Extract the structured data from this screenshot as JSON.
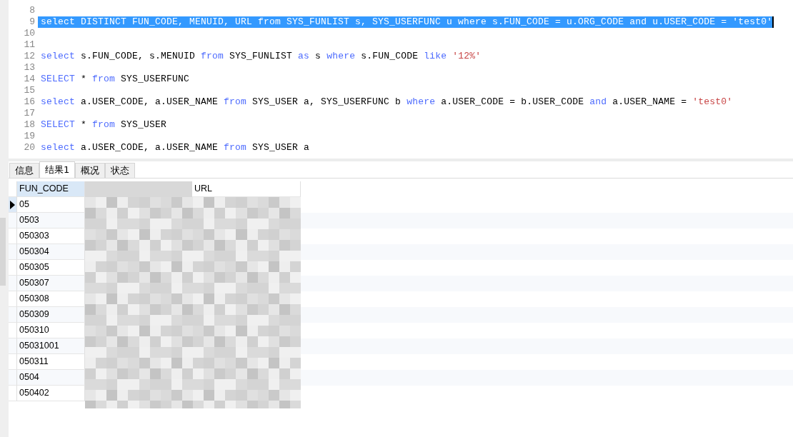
{
  "editor": {
    "lines": [
      {
        "number": "8",
        "selected": false
      },
      {
        "number": "9",
        "selected": true,
        "tokens": [
          {
            "kind": "plain",
            "text": "select DISTINCT FUN_CODE, MENUID, URL from SYS_FUNLIST s, SYS_USERFUNC u where s.FUN_CODE = u.ORG_CODE and u.USER_CODE = 'test0'"
          }
        ]
      },
      {
        "number": "10",
        "selected": false
      },
      {
        "number": "11",
        "selected": false
      },
      {
        "number": "12",
        "selected": false,
        "tokens": [
          {
            "kind": "keyword",
            "text": "select"
          },
          {
            "kind": "plain",
            "text": " s.FUN_CODE, s.MENUID "
          },
          {
            "kind": "keyword",
            "text": "from"
          },
          {
            "kind": "plain",
            "text": " SYS_FUNLIST "
          },
          {
            "kind": "keyword",
            "text": "as"
          },
          {
            "kind": "plain",
            "text": " s "
          },
          {
            "kind": "keyword",
            "text": "where"
          },
          {
            "kind": "plain",
            "text": " s.FUN_CODE "
          },
          {
            "kind": "keyword",
            "text": "like"
          },
          {
            "kind": "string",
            "text": " '12%'"
          }
        ]
      },
      {
        "number": "13",
        "selected": false
      },
      {
        "number": "14",
        "selected": false,
        "tokens": [
          {
            "kind": "keyword",
            "text": "SELECT"
          },
          {
            "kind": "plain",
            "text": " * "
          },
          {
            "kind": "keyword",
            "text": "from"
          },
          {
            "kind": "plain",
            "text": " SYS_USERFUNC"
          }
        ]
      },
      {
        "number": "15",
        "selected": false
      },
      {
        "number": "16",
        "selected": false,
        "tokens": [
          {
            "kind": "keyword",
            "text": "select"
          },
          {
            "kind": "plain",
            "text": " a.USER_CODE, a.USER_NAME "
          },
          {
            "kind": "keyword",
            "text": "from"
          },
          {
            "kind": "plain",
            "text": " SYS_USER a, SYS_USERFUNC b "
          },
          {
            "kind": "keyword",
            "text": "where"
          },
          {
            "kind": "plain",
            "text": " a.USER_CODE = b.USER_CODE "
          },
          {
            "kind": "keyword",
            "text": "and"
          },
          {
            "kind": "plain",
            "text": " a.USER_NAME = "
          },
          {
            "kind": "string",
            "text": "'test0'"
          }
        ]
      },
      {
        "number": "17",
        "selected": false
      },
      {
        "number": "18",
        "selected": false,
        "tokens": [
          {
            "kind": "keyword",
            "text": "SELECT"
          },
          {
            "kind": "plain",
            "text": " * "
          },
          {
            "kind": "keyword",
            "text": "from"
          },
          {
            "kind": "plain",
            "text": " SYS_USER"
          }
        ]
      },
      {
        "number": "19",
        "selected": false
      },
      {
        "number": "20",
        "selected": false,
        "tokens": [
          {
            "kind": "keyword",
            "text": "select"
          },
          {
            "kind": "plain",
            "text": " a.USER_CODE, a.USER_NAME "
          },
          {
            "kind": "keyword",
            "text": "from"
          },
          {
            "kind": "plain",
            "text": " SYS_USER a"
          }
        ]
      }
    ]
  },
  "tabs": [
    {
      "label": "信息",
      "selected": false
    },
    {
      "label": "结果1",
      "selected": true
    },
    {
      "label": "概况",
      "selected": false
    },
    {
      "label": "状态",
      "selected": false
    }
  ],
  "table": {
    "columns": [
      "FUN_CODE",
      "URL"
    ],
    "rows": [
      {
        "fun_code": "05",
        "selected": true
      },
      {
        "fun_code": "0503",
        "selected": false
      },
      {
        "fun_code": "050303",
        "selected": false
      },
      {
        "fun_code": "050304",
        "selected": false
      },
      {
        "fun_code": "050305",
        "selected": false
      },
      {
        "fun_code": "050307",
        "selected": false
      },
      {
        "fun_code": "050308",
        "selected": false
      },
      {
        "fun_code": "050309",
        "selected": false
      },
      {
        "fun_code": "050310",
        "selected": false
      },
      {
        "fun_code": "05031001",
        "selected": false
      },
      {
        "fun_code": "050311",
        "selected": false
      },
      {
        "fun_code": "0504",
        "selected": false
      },
      {
        "fun_code": "050402",
        "selected": false
      }
    ]
  }
}
